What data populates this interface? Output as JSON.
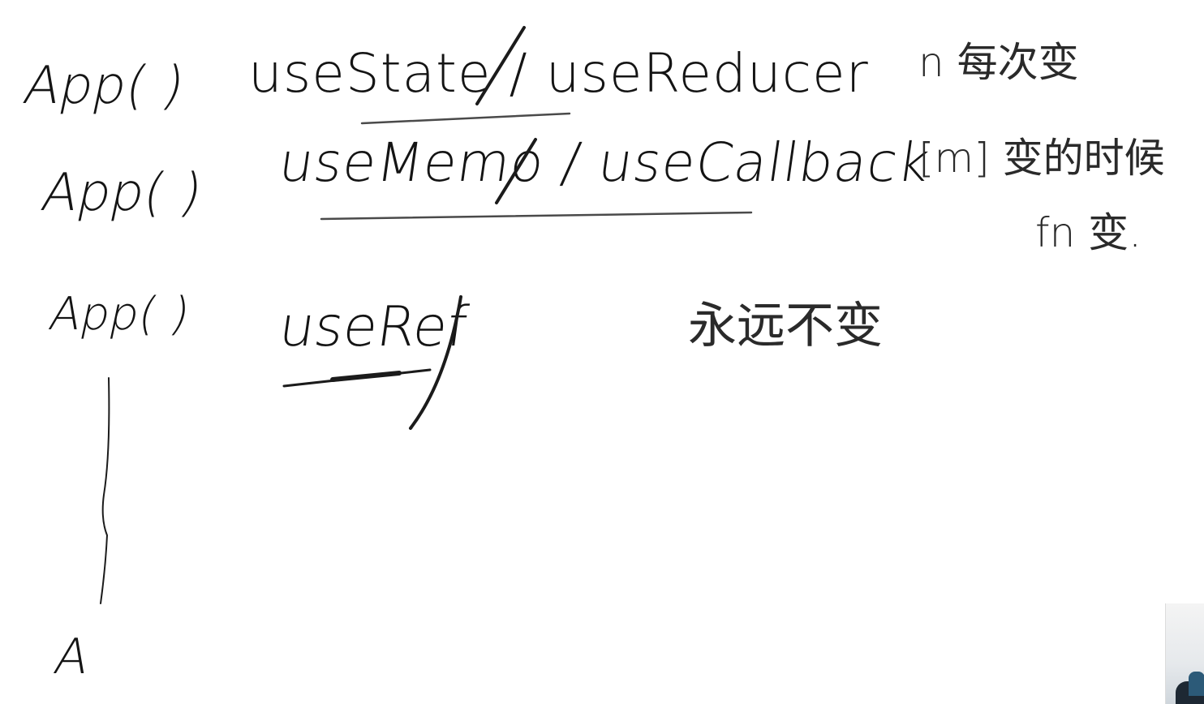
{
  "board": {
    "app_calls": [
      "App( )",
      "App( )",
      "App( )",
      "A"
    ],
    "hooks": [
      {
        "name": "useState / useReducer",
        "note": "n 每次变"
      },
      {
        "name": "useMemo / useCallback",
        "note": "[m] 变的时候",
        "note2": "fn 变."
      },
      {
        "name": "useRef",
        "note": "永远不变"
      }
    ]
  }
}
